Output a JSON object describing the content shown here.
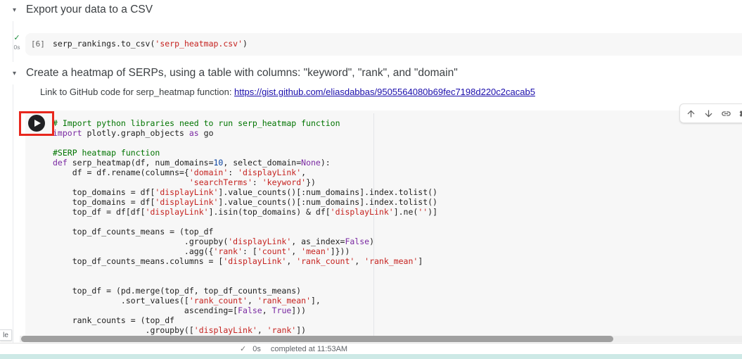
{
  "colors": {
    "cell_background": "#f7f7f7",
    "annotation_red": "#e8271d",
    "link_blue": "#1a0dab",
    "comment_green": "#007400",
    "string_red": "#c5221f",
    "keyword_purple": "#7928a1",
    "number_blue": "#0842a0",
    "success_green": "#1e8e3e",
    "bottom_strip_teal": "#cde9e6"
  },
  "sections": [
    {
      "title": "Export your data to a CSV"
    },
    {
      "title": "Create a heatmap of SERPs, using a table with columns: \"keyword\", \"rank\", and \"domain\""
    }
  ],
  "github_link": {
    "label": "Link to GitHub code for serp_heatmap function: ",
    "url": "https://gist.github.com/eliasdabbas/9505564080b69fec7198d220c2cacab5"
  },
  "cells": [
    {
      "execution_count": "[6]",
      "status_check": "✓",
      "runtime": "0s",
      "code_lines": [
        "serp_rankings.to_csv('serp_heatmap.csv')"
      ]
    },
    {
      "code_lines": [
        "# Import python libraries need to run serp_heatmap function",
        "import plotly.graph_objects as go",
        "",
        "#SERP heatmap function",
        "def serp_heatmap(df, num_domains=10, select_domain=None):",
        "    df = df.rename(columns={'domain': 'displayLink',",
        "                            'searchTerms': 'keyword'})",
        "    top_domains = df['displayLink'].value_counts()[:num_domains].index.tolist()",
        "    top_domains = df['displayLink'].value_counts()[:num_domains].index.tolist()",
        "    top_df = df[df['displayLink'].isin(top_domains) & df['displayLink'].ne('')]",
        "",
        "    top_df_counts_means = (top_df",
        "                           .groupby('displayLink', as_index=False)",
        "                           .agg({'rank': ['count', 'mean']}))",
        "    top_df_counts_means.columns = ['displayLink', 'rank_count', 'rank_mean']",
        "",
        "",
        "    top_df = (pd.merge(top_df, top_df_counts_means)",
        "              .sort_values(['rank_count', 'rank_mean'],",
        "                           ascending=[False, True]))",
        "    rank_counts = (top_df",
        "                   .groupby(['displayLink', 'rank'])"
      ]
    }
  ],
  "cell_toolbar": {
    "icons": [
      "move-cell-up",
      "move-cell-down",
      "copy-link-to-cell",
      "cell-settings",
      "more-cell-actions"
    ]
  },
  "footer": {
    "check": "✓",
    "runtime": "0s",
    "completed": "completed at 11:53AM"
  },
  "misc": {
    "clipped_left_label": "le",
    "collapse_arrow": "▾"
  }
}
